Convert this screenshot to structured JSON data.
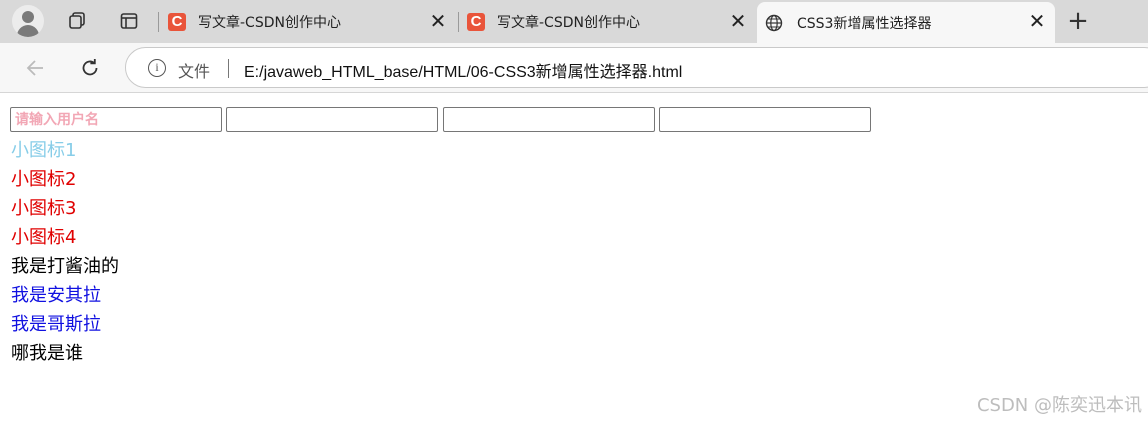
{
  "browser": {
    "tabs": [
      {
        "title": "写文章-CSDN创作中心",
        "favicon": "C"
      },
      {
        "title": "写文章-CSDN创作中心",
        "favicon": "C"
      },
      {
        "title": "CSS3新增属性选择器",
        "favicon": "globe-icon",
        "active": true
      }
    ],
    "close_glyph": "✕",
    "newtab_glyph": "+",
    "address": {
      "file_label": "文件",
      "url": "E:/javaweb_HTML_base/HTML/06-CSS3新增属性选择器.html"
    }
  },
  "page": {
    "inputs": [
      {
        "placeholder": "请输入用户名",
        "value": ""
      },
      {
        "placeholder": "",
        "value": ""
      },
      {
        "placeholder": "",
        "value": ""
      },
      {
        "placeholder": "",
        "value": ""
      }
    ],
    "lines": [
      {
        "text": "小图标1",
        "color": "#87cde8"
      },
      {
        "text": "小图标2",
        "color": "#e00000"
      },
      {
        "text": "小图标3",
        "color": "#e00000"
      },
      {
        "text": "小图标4",
        "color": "#e00000"
      },
      {
        "text": "我是打酱油的",
        "color": "#000000"
      },
      {
        "text": "我是安其拉",
        "color": "#1010e0"
      },
      {
        "text": "我是哥斯拉",
        "color": "#1010e0"
      },
      {
        "text": "哪我是谁",
        "color": "#000000"
      }
    ],
    "watermark": "CSDN @陈奕迅本讯"
  }
}
